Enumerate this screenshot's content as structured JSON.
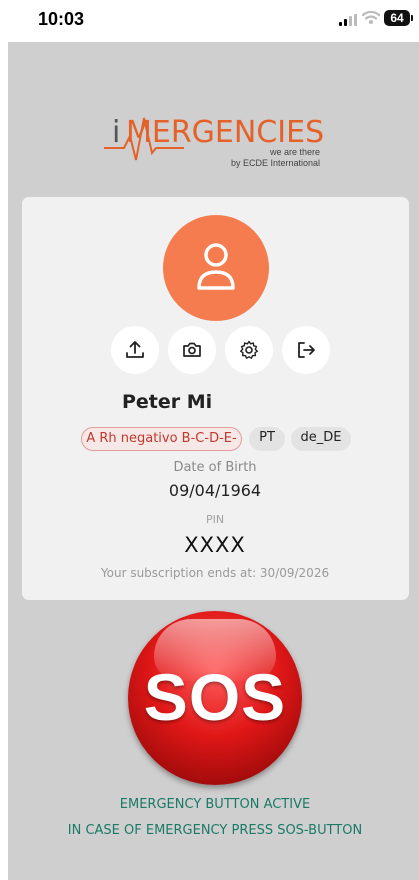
{
  "status_bar": {
    "time": "10:03",
    "battery": "64"
  },
  "logo": {
    "name": "iMERGENCIES",
    "tagline": "we are there",
    "byline": "by ECDE International"
  },
  "profile": {
    "name": "Peter Mi",
    "blood_type": "A Rh negativo B-C-D-E-",
    "country": "PT",
    "locale": "de_DE",
    "dob_label": "Date of Birth",
    "dob": "09/04/1964",
    "pin_label": "PIN",
    "pin": "XXXX",
    "subscription": "Your subscription ends at: 30/09/2026"
  },
  "actions": [
    {
      "icon": "upload-icon"
    },
    {
      "icon": "camera-icon"
    },
    {
      "icon": "gear-icon"
    },
    {
      "icon": "logout-icon"
    }
  ],
  "sos": {
    "label": "SOS"
  },
  "emergency": {
    "line1": "EMERGENCY BUTTON ACTIVE",
    "line2": "IN CASE OF EMERGENCY PRESS SOS-BUTTON"
  },
  "colors": {
    "accent": "#f47c4e",
    "brand": "#e4622a",
    "sos": "#e01717",
    "status_text": "#1b7a66"
  }
}
